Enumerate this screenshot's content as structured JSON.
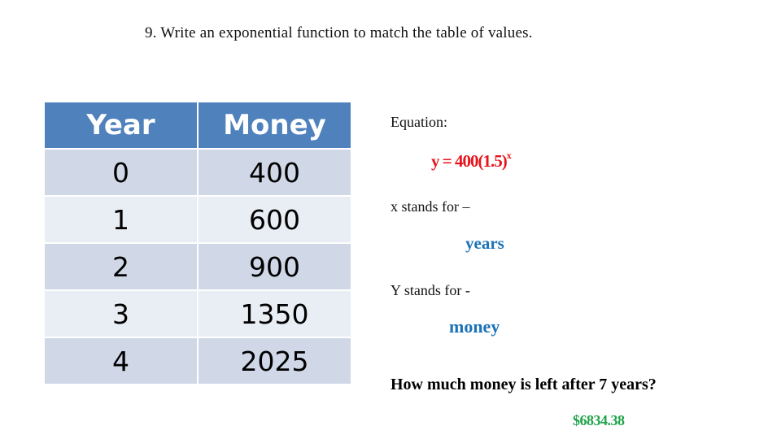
{
  "title": "9. Write an exponential function to match the table of values.",
  "table": {
    "headers": [
      "Year",
      "Money"
    ],
    "rows": [
      [
        "0",
        "400"
      ],
      [
        "1",
        "600"
      ],
      [
        "2",
        "900"
      ],
      [
        "3",
        "1350"
      ],
      [
        "4",
        "2025"
      ]
    ]
  },
  "equation": {
    "label": "Equation:",
    "answer_base": "y = 400(1.5)",
    "answer_exponent": "x"
  },
  "x_meaning": {
    "label": "x stands for –",
    "answer": "years"
  },
  "y_meaning": {
    "label": "Y stands for -",
    "answer": "money"
  },
  "question": {
    "text": "How much money is left after 7 years?",
    "answer": "$6834.38"
  },
  "colors": {
    "header_bg": "#4f81bd",
    "row_dark": "#d0d8e8",
    "row_light": "#e9edf4",
    "equation_answer": "#e8141d",
    "meaning_answer": "#1a72b8",
    "money_answer": "#1fa34a"
  }
}
